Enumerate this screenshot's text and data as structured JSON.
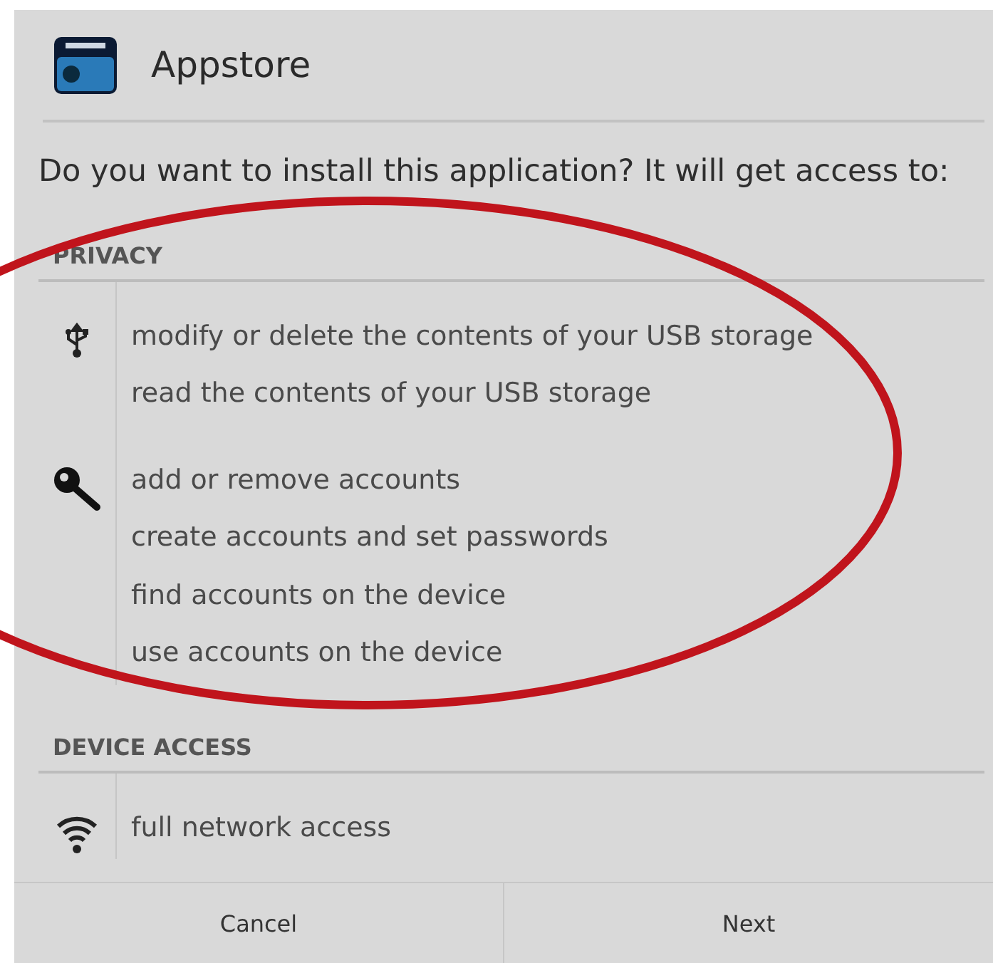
{
  "dialog": {
    "title": "Appstore",
    "prompt": "Do you want to install this application? It will get access to:"
  },
  "sections": [
    {
      "heading": "PRIVACY",
      "groups": [
        {
          "kind": "usb",
          "permissions": [
            "modify or delete the contents of your USB storage",
            "read the contents of your USB storage"
          ]
        },
        {
          "kind": "key",
          "permissions": [
            "add or remove accounts",
            "create accounts and set passwords",
            "find accounts on the device",
            "use accounts on the device"
          ]
        }
      ]
    },
    {
      "heading": "DEVICE ACCESS",
      "groups": [
        {
          "kind": "wifi",
          "permissions": [
            "full network access"
          ]
        }
      ]
    }
  ],
  "buttons": [
    "Cancel",
    "Next"
  ],
  "annotation": {
    "kind": "ellipse"
  }
}
